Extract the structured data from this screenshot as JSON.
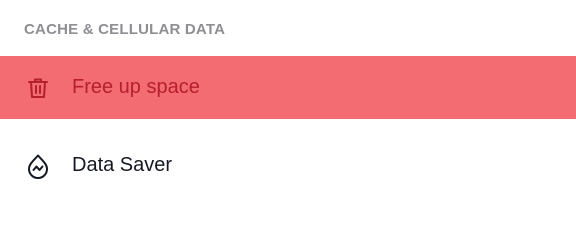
{
  "section": {
    "header": "CACHE & CELLULAR DATA"
  },
  "rows": [
    {
      "label": "Free up space",
      "icon": "trash-icon",
      "state": "highlighted"
    },
    {
      "label": "Data Saver",
      "icon": "data-saver-icon"
    }
  ],
  "colors": {
    "highlight_bg": "#f26c72",
    "highlight_text": "#b5202c",
    "header_text": "#8e8e93",
    "row_text": "#161823"
  }
}
